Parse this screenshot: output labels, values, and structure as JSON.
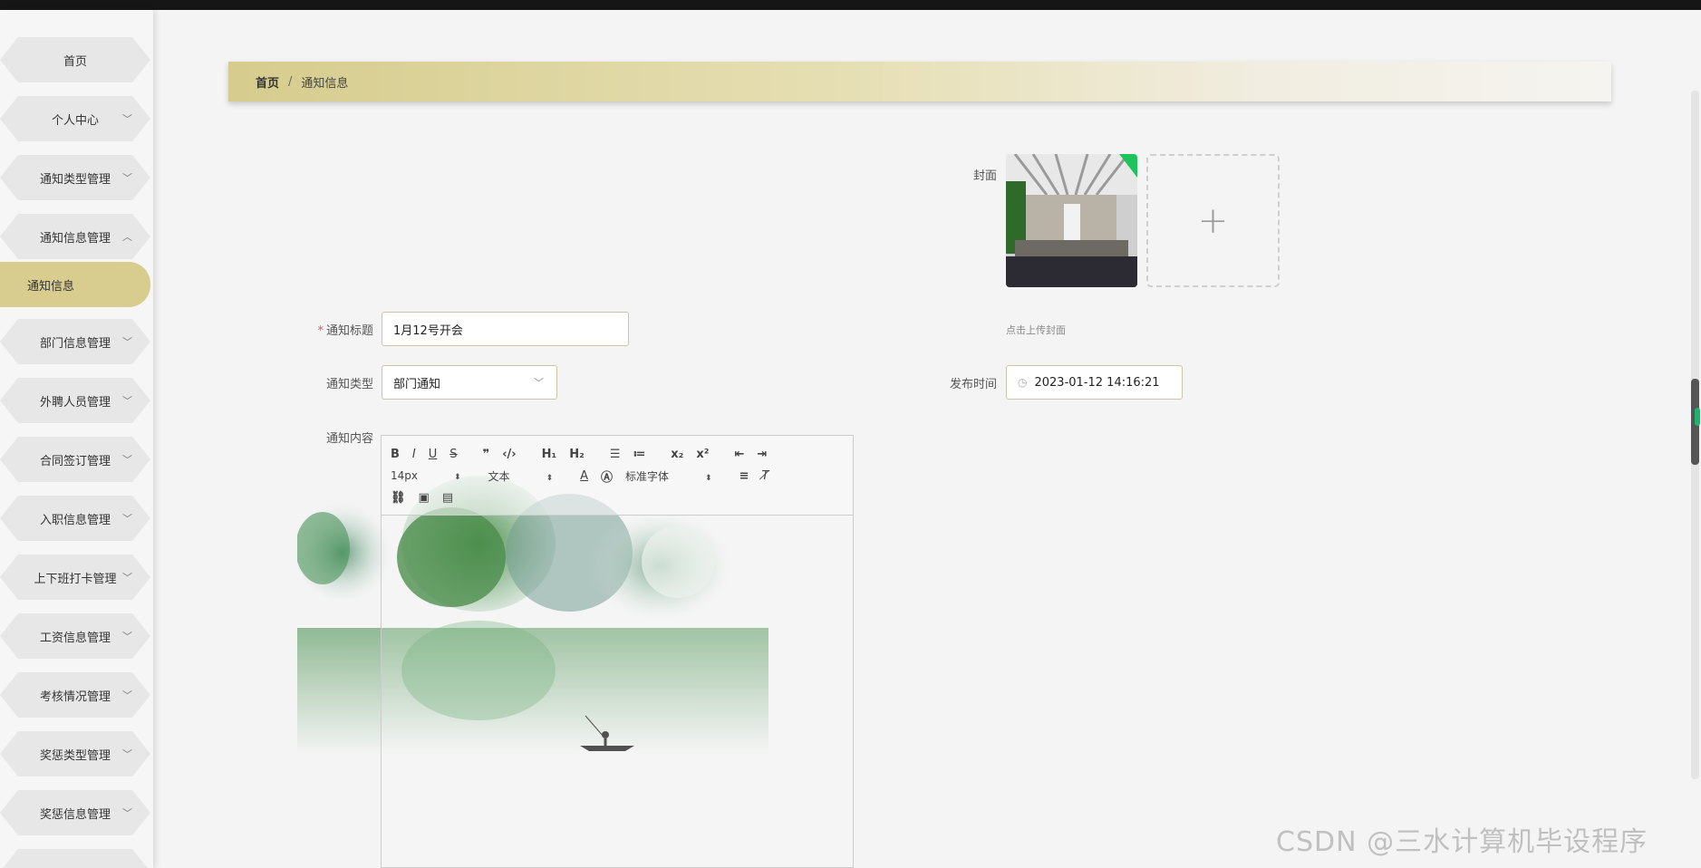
{
  "sidebar": {
    "items": [
      {
        "label": "首页",
        "chevron": ""
      },
      {
        "label": "个人中心",
        "chevron": "﹀"
      },
      {
        "label": "通知类型管理",
        "chevron": "﹀"
      },
      {
        "label": "通知信息管理",
        "chevron": "︿"
      },
      {
        "label": "通知信息",
        "chevron": ""
      },
      {
        "label": "部门信息管理",
        "chevron": "﹀"
      },
      {
        "label": "外聘人员管理",
        "chevron": "﹀"
      },
      {
        "label": "合同签订管理",
        "chevron": "﹀"
      },
      {
        "label": "入职信息管理",
        "chevron": "﹀"
      },
      {
        "label": "上下班打卡管理",
        "chevron": "﹀"
      },
      {
        "label": "工资信息管理",
        "chevron": "﹀"
      },
      {
        "label": "考核情况管理",
        "chevron": "﹀"
      },
      {
        "label": "奖惩类型管理",
        "chevron": "﹀"
      },
      {
        "label": "奖惩信息管理",
        "chevron": "﹀"
      }
    ]
  },
  "breadcrumb": {
    "home": "首页",
    "separator": "/",
    "current": "通知信息"
  },
  "form": {
    "title_label": "通知标题",
    "title_required": "*",
    "title_value": "1月12号开会",
    "type_label": "通知类型",
    "type_value": "部门通知",
    "content_label": "通知内容",
    "cover_label": "封面",
    "upload_plus": "+",
    "upload_tip": "点击上传封面",
    "time_label": "发布时间",
    "time_value": "2023-01-12 14:16:21"
  },
  "editor": {
    "font_size": "14px",
    "header_select": "文本",
    "font_family": "标准字体"
  },
  "watermark": "CSDN @三水计算机毕设程序",
  "colors": {
    "accent": "#d8cd8e",
    "sidebar_item": "#e7e7e7",
    "topbar": "#161616"
  }
}
